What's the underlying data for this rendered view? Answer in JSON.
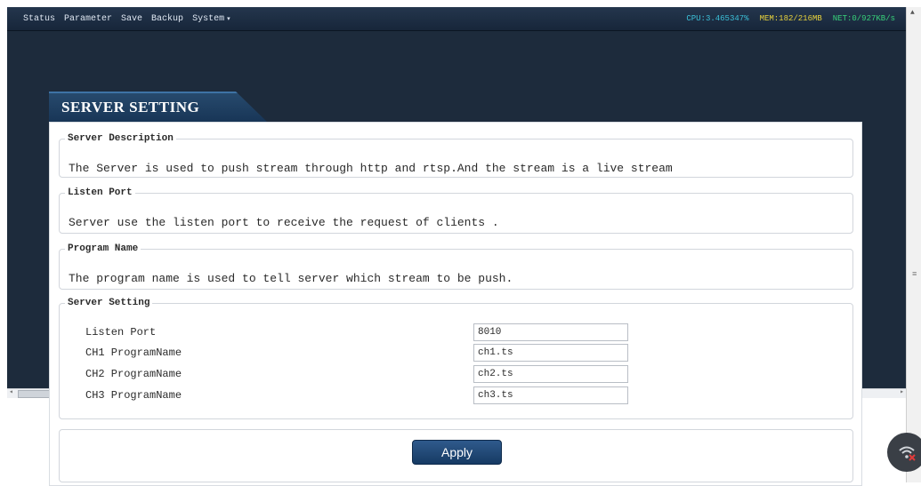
{
  "nav": {
    "items": [
      "Status",
      "Parameter",
      "Save",
      "Backup",
      "System"
    ],
    "system_caret": "▾"
  },
  "stats": {
    "cpu": "CPU:3.465347%",
    "mem": "MEM:182/216MB",
    "net": "NET:0/927KB/s"
  },
  "panel": {
    "title": "SERVER SETTING",
    "server_description": {
      "legend": "Server Description",
      "text": "The Server is used to push stream through http and rtsp.And the stream is a live stream"
    },
    "listen_port": {
      "legend": "Listen Port",
      "text": "Server use the listen port to receive the request of clients ."
    },
    "program_name": {
      "legend": "Program Name",
      "text": "The program name is used to tell server which stream to be push."
    },
    "server_setting": {
      "legend": "Server Setting",
      "rows": [
        {
          "label": "Listen Port",
          "value": "8010"
        },
        {
          "label": "CH1 ProgramName",
          "value": "ch1.ts"
        },
        {
          "label": "CH2 ProgramName",
          "value": "ch2.ts"
        },
        {
          "label": "CH3 ProgramName",
          "value": "ch3.ts"
        }
      ]
    },
    "apply_label": "Apply"
  },
  "colors": {
    "topbar": "#1d2b3c",
    "tab": "#1f426a",
    "apply": "#1f4a7a"
  },
  "icons": {
    "fab": "wifi-off-icon"
  }
}
